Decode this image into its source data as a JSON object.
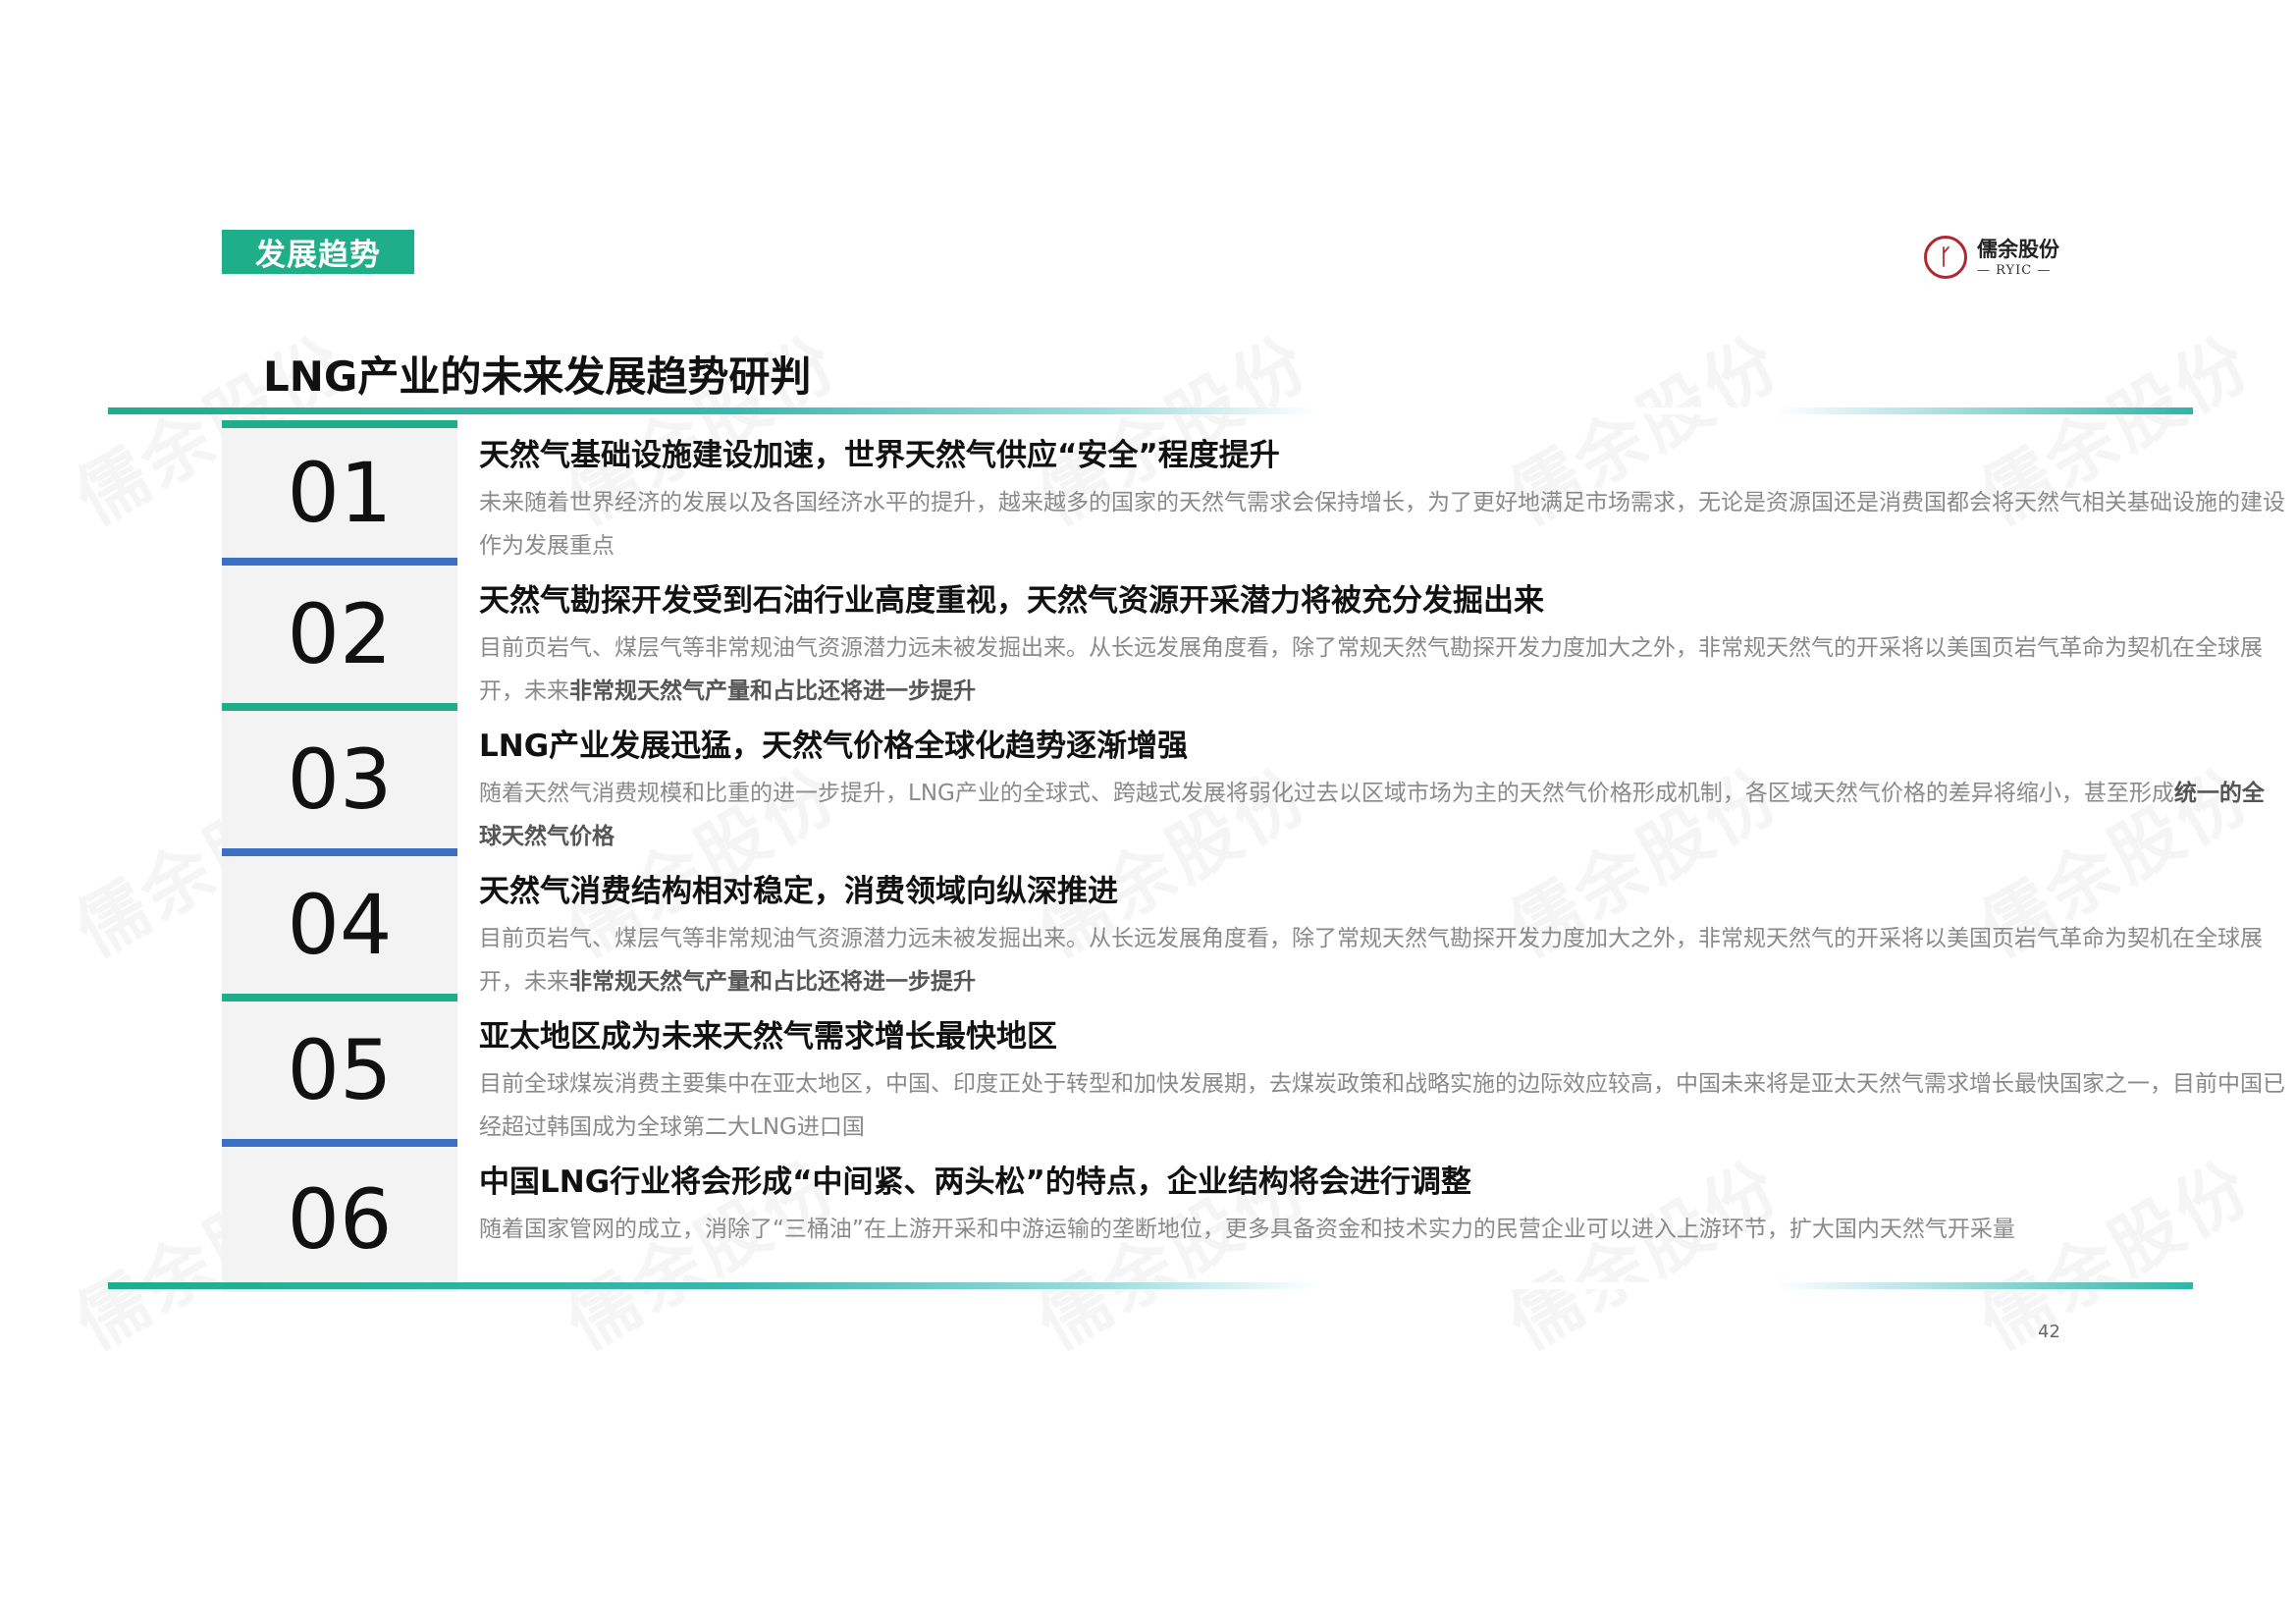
{
  "section_tag": "发展趋势",
  "logo": {
    "name": "儒余股份",
    "sub": "— RYIC —"
  },
  "title": "LNG产业的未来发展趋势研判",
  "watermark": "儒余股份",
  "items": [
    {
      "num": "01",
      "title": "天然气基础设施建设加速，世界天然气供应“安全”程度提升",
      "desc": "未来随着世界经济的发展以及各国经济水平的提升，越来越多的国家的天然气需求会保持增长，为了更好地满足市场需求，无论是资源国还是消费国都会将天然气相关基础设施的建设作为发展重点",
      "desc_bold": ""
    },
    {
      "num": "02",
      "title": "天然气勘探开发受到石油行业高度重视，天然气资源开采潜力将被充分发掘出来",
      "desc": "目前页岩气、煤层气等非常规油气资源潜力远未被发掘出来。从长远发展角度看，除了常规天然气勘探开发力度加大之外，非常规天然气的开采将以美国页岩气革命为契机在全球展开，未来",
      "desc_bold": "非常规天然气产量和占比还将进一步提升"
    },
    {
      "num": "03",
      "title": "LNG产业发展迅猛，天然气价格全球化趋势逐渐增强",
      "desc": "随着天然气消费规模和比重的进一步提升，LNG产业的全球式、跨越式发展将弱化过去以区域市场为主的天然气价格形成机制，各区域天然气价格的差异将缩小，甚至形成",
      "desc_bold": "统一的全球天然气价格"
    },
    {
      "num": "04",
      "title": "天然气消费结构相对稳定，消费领域向纵深推进",
      "desc": "目前页岩气、煤层气等非常规油气资源潜力远未被发掘出来。从长远发展角度看，除了常规天然气勘探开发力度加大之外，非常规天然气的开采将以美国页岩气革命为契机在全球展开，未来",
      "desc_bold": "非常规天然气产量和占比还将进一步提升"
    },
    {
      "num": "05",
      "title": "亚太地区成为未来天然气需求增长最快地区",
      "desc": "目前全球煤炭消费主要集中在亚太地区，中国、印度正处于转型和加快发展期，去煤炭政策和战略实施的边际效应较高，中国未来将是亚太天然气需求增长最快国家之一，目前中国已经超过韩国成为全球第二大LNG进口国",
      "desc_bold": ""
    },
    {
      "num": "06",
      "title": "中国LNG行业将会形成“中间紧、两头松”的特点，企业结构将会进行调整",
      "desc": "随着国家管网的成立，消除了“三桶油”在上游开采和中游运输的垄断地位，更多具备资金和技术实力的民营企业可以进入上游环节，扩大国内天然气开采量",
      "desc_bold": ""
    }
  ],
  "page_number": "42"
}
